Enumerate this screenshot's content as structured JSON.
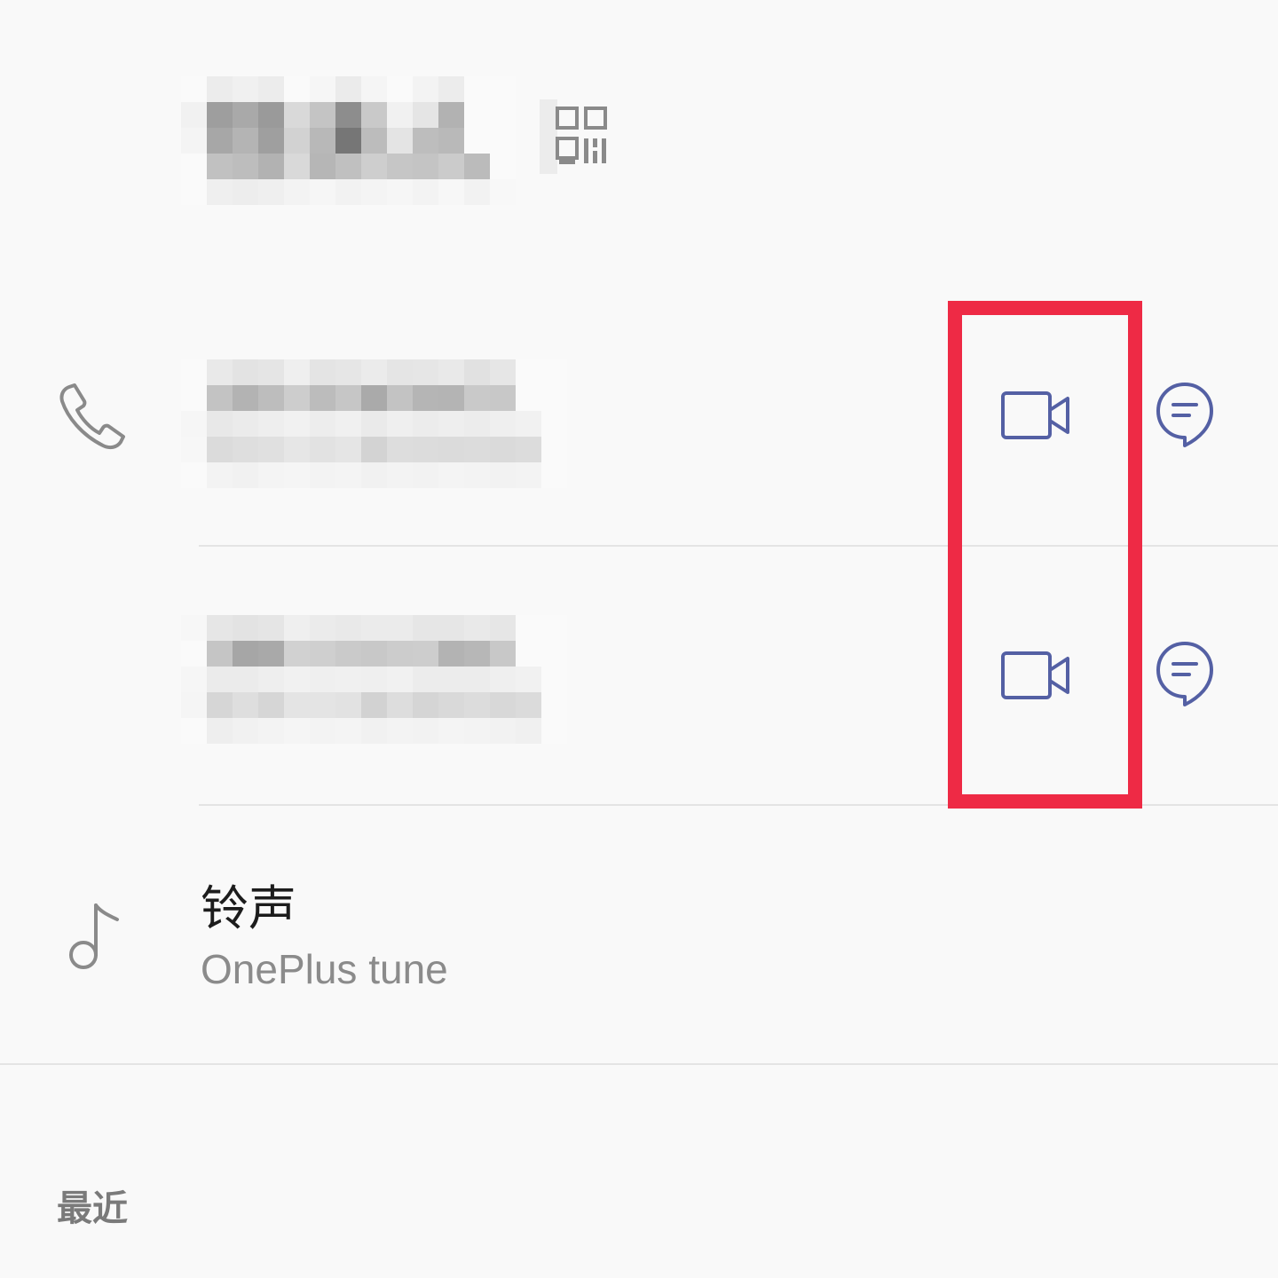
{
  "contact": {
    "name_redacted": true,
    "qr_icon": "qr-code-icon"
  },
  "phone_section": {
    "phone_icon": "phone-icon",
    "numbers": [
      {
        "redacted": true,
        "video_icon": "video-call-icon",
        "message_icon": "message-icon"
      },
      {
        "redacted": true,
        "video_icon": "video-call-icon",
        "message_icon": "message-icon"
      }
    ]
  },
  "ringtone": {
    "icon": "music-note-icon",
    "title": "铃声",
    "value": "OnePlus tune"
  },
  "recent": {
    "label": "最近"
  },
  "colors": {
    "accent": "#5460a4",
    "highlight": "#ee2a45",
    "icon_gray": "#8a8a8a",
    "background": "#f9f9f9"
  }
}
